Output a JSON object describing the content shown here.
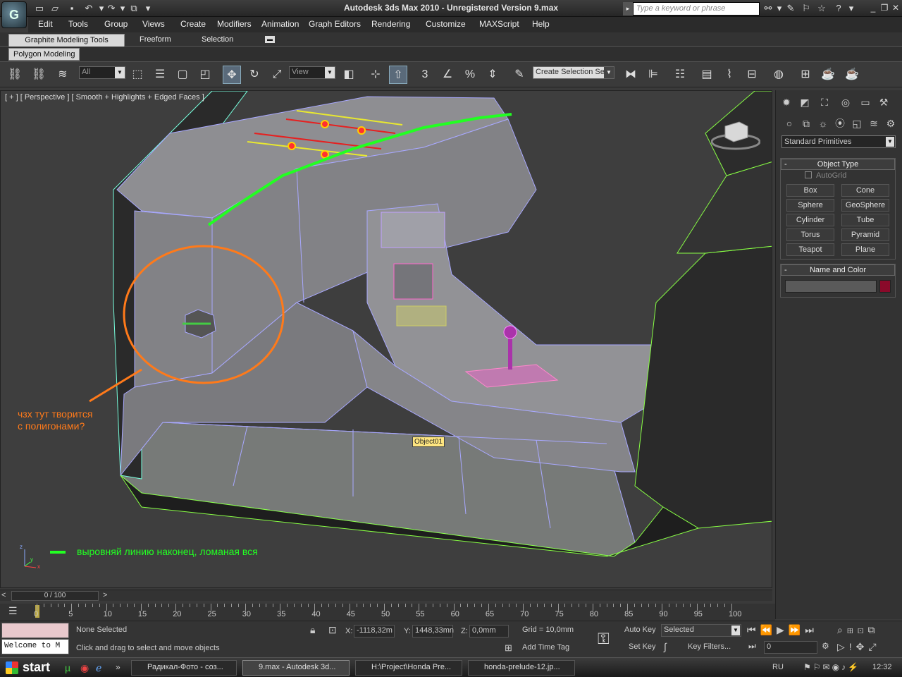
{
  "title": {
    "text": "Autodesk 3ds Max  2010   - Unregistered Version     9.max",
    "logo": "3ds-max-logo-icon",
    "search_placeholder": "Type a keyword or phrase"
  },
  "menu": [
    "Edit",
    "Tools",
    "Group",
    "Views",
    "Create",
    "Modifiers",
    "Animation",
    "Graph Editors",
    "Rendering",
    "Customize",
    "MAXScript",
    "Help"
  ],
  "ribbon": {
    "tabs": [
      "Graphite Modeling Tools",
      "Freeform",
      "Selection"
    ],
    "active_tab": "Graphite Modeling Tools",
    "panel_tab": "Polygon Modeling"
  },
  "toolbar": {
    "filter_value": "All",
    "refcoord_value": "View",
    "selection_set_placeholder": "Create Selection Se",
    "snap_label": "3"
  },
  "viewport": {
    "label": "[ + ] [ Perspective ] [ Smooth + Highlights + Edged Faces ]",
    "object_tooltip": "Object01",
    "annotation_orange_line1": "чзх тут творится",
    "annotation_orange_line2": "с полигонами?",
    "annotation_green": "выровняй линию наконец, ломаная вся",
    "axis_labels": [
      "z",
      "y",
      "x"
    ]
  },
  "command_panel": {
    "category": "Standard Primitives",
    "object_type_title": "Object Type",
    "autogrid_label": "AutoGrid",
    "primitives": [
      "Box",
      "Cone",
      "Sphere",
      "GeoSphere",
      "Cylinder",
      "Tube",
      "Torus",
      "Pyramid",
      "Teapot",
      "Plane"
    ],
    "name_color_title": "Name and Color",
    "swatch_color": "#8a0a2a"
  },
  "timeline": {
    "slider_label": "0 / 100",
    "ticks": [
      "0",
      "5",
      "10",
      "15",
      "20",
      "25",
      "30",
      "35",
      "40",
      "45",
      "50",
      "55",
      "60",
      "65",
      "70",
      "75",
      "80",
      "85",
      "90",
      "95",
      "100"
    ]
  },
  "status": {
    "selection": "None Selected",
    "prompt": "Click and drag to select and move objects",
    "maxscript_listener": "Welcome to M",
    "x_label": "X:",
    "x_value": "-1118,32m",
    "y_label": "Y:",
    "y_value": "1448,33mn",
    "z_label": "Z:",
    "z_value": "0,0mm",
    "grid": "Grid = 10,0mm",
    "add_time_tag": "Add Time Tag",
    "auto_key": "Auto Key",
    "set_key": "Set Key",
    "selected_dropdown": "Selected",
    "key_filters": "Key Filters...",
    "frame_value": "0"
  },
  "taskbar": {
    "start": "start",
    "tasks": [
      "Радикал-Фото - соз...",
      "9.max - Autodesk 3d...",
      "H:\\Project\\Honda Pre...",
      "honda-prelude-12.jp..."
    ],
    "lang": "RU",
    "time": "12:32"
  },
  "colors": {
    "annotation_orange": "#ff7a1a",
    "annotation_green": "#22ff22",
    "wire_color": "#a8a8ff",
    "viewport_bg": "#3e3e3e"
  }
}
